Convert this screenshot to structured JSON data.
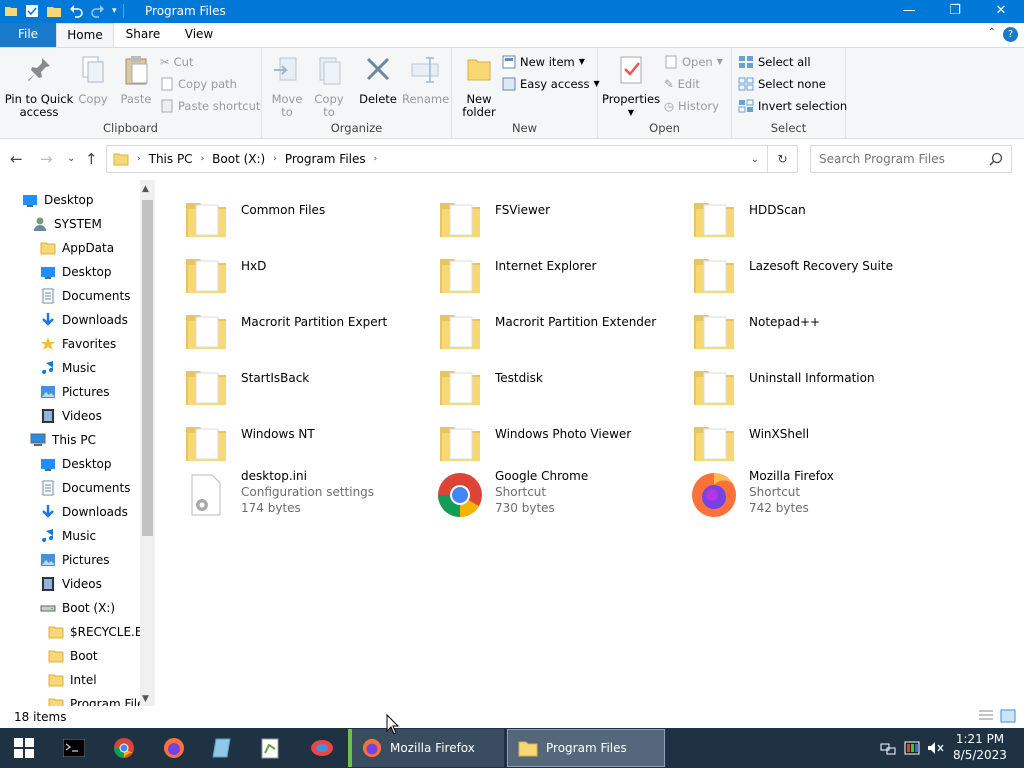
{
  "window": {
    "title": "Program Files",
    "controls": {
      "minimize": "—",
      "maximize": "❐",
      "close": "✕"
    }
  },
  "ribbon_tabs": [
    "File",
    "Home",
    "Share",
    "View"
  ],
  "ribbon": {
    "clipboard": {
      "label": "Clipboard",
      "pin": "Pin to Quick access",
      "copy": "Copy",
      "paste": "Paste",
      "cut": "Cut",
      "copy_path": "Copy path",
      "paste_shortcut": "Paste shortcut"
    },
    "organize": {
      "label": "Organize",
      "move_to": "Move to",
      "copy_to": "Copy to",
      "delete": "Delete",
      "rename": "Rename"
    },
    "new": {
      "label": "New",
      "new_folder": "New folder",
      "new_item": "New item",
      "easy_access": "Easy access"
    },
    "open": {
      "label": "Open",
      "properties": "Properties",
      "open": "Open",
      "edit": "Edit",
      "history": "History"
    },
    "select": {
      "label": "Select",
      "select_all": "Select all",
      "select_none": "Select none",
      "invert": "Invert selection"
    }
  },
  "address": {
    "crumbs": [
      "This PC",
      "Boot (X:)",
      "Program Files"
    ],
    "search_placeholder": "Search Program Files"
  },
  "nav_tree": [
    {
      "label": "Desktop",
      "icon": "desktop-blue-icon"
    },
    {
      "label": "SYSTEM",
      "icon": "user-icon"
    },
    {
      "label": "AppData",
      "icon": "folder-icon"
    },
    {
      "label": "Desktop",
      "icon": "desktop-blue-icon"
    },
    {
      "label": "Documents",
      "icon": "documents-icon"
    },
    {
      "label": "Downloads",
      "icon": "downloads-icon"
    },
    {
      "label": "Favorites",
      "icon": "star-icon"
    },
    {
      "label": "Music",
      "icon": "music-icon"
    },
    {
      "label": "Pictures",
      "icon": "pictures-icon"
    },
    {
      "label": "Videos",
      "icon": "videos-icon"
    },
    {
      "label": "This PC",
      "icon": "computer-icon"
    },
    {
      "label": "Desktop",
      "icon": "desktop-blue-icon"
    },
    {
      "label": "Documents",
      "icon": "documents-icon"
    },
    {
      "label": "Downloads",
      "icon": "downloads-icon"
    },
    {
      "label": "Music",
      "icon": "music-icon"
    },
    {
      "label": "Pictures",
      "icon": "pictures-icon"
    },
    {
      "label": "Videos",
      "icon": "videos-icon"
    },
    {
      "label": "Boot (X:)",
      "icon": "drive-icon"
    },
    {
      "label": "$RECYCLE.BIN",
      "icon": "folder-icon"
    },
    {
      "label": "Boot",
      "icon": "folder-icon"
    },
    {
      "label": "Intel",
      "icon": "folder-icon"
    },
    {
      "label": "Program Files",
      "icon": "folder-icon"
    }
  ],
  "items": [
    {
      "name": "Common Files",
      "kind": "folder"
    },
    {
      "name": "FSViewer",
      "kind": "folder"
    },
    {
      "name": "HDDScan",
      "kind": "folder"
    },
    {
      "name": "HxD",
      "kind": "folder"
    },
    {
      "name": "Internet Explorer",
      "kind": "folder"
    },
    {
      "name": "Lazesoft Recovery Suite",
      "kind": "folder"
    },
    {
      "name": "Macrorit Partition Expert",
      "kind": "folder"
    },
    {
      "name": "Macrorit Partition Extender",
      "kind": "folder"
    },
    {
      "name": "Notepad++",
      "kind": "folder"
    },
    {
      "name": "StartIsBack",
      "kind": "folder"
    },
    {
      "name": "Testdisk",
      "kind": "folder"
    },
    {
      "name": "Uninstall Information",
      "kind": "folder"
    },
    {
      "name": "Windows NT",
      "kind": "folder"
    },
    {
      "name": "Windows Photo Viewer",
      "kind": "folder"
    },
    {
      "name": "WinXShell",
      "kind": "folder"
    },
    {
      "name": "desktop.ini",
      "kind": "ini",
      "type": "Configuration settings",
      "size": "174 bytes"
    },
    {
      "name": "Google Chrome",
      "kind": "chrome",
      "type": "Shortcut",
      "size": "730 bytes"
    },
    {
      "name": "Mozilla Firefox",
      "kind": "firefox",
      "type": "Shortcut",
      "size": "742 bytes"
    }
  ],
  "status": {
    "count": "18 items"
  },
  "taskbar": {
    "windows": [
      {
        "label": "Mozilla Firefox",
        "icon": "firefox-icon"
      },
      {
        "label": "Program Files",
        "icon": "folder-icon"
      }
    ],
    "time": "1:21 PM",
    "date": "8/5/2023"
  },
  "colors": {
    "accent": "#0078d7",
    "taskbar": "#1f3244",
    "folder": "#f8d775"
  }
}
